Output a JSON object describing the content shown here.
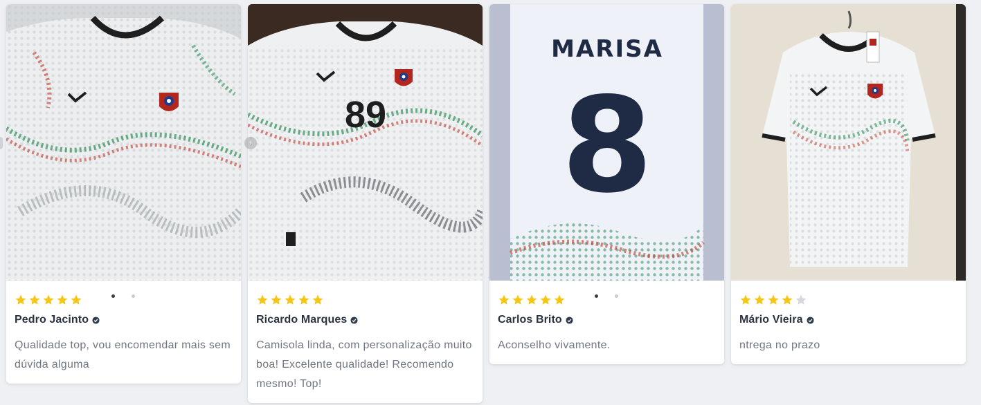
{
  "reviews": [
    {
      "rating": 5,
      "name": "Pedro Jacinto",
      "text": "Qualidade top, vou encomendar mais sem dúvida alguma",
      "photo": "white-jersey-front-logo",
      "has_dots": true,
      "active_dot": 0
    },
    {
      "rating": 5,
      "name": "Ricardo Marques",
      "text": "Camisola linda, com personalização muito boa! Excelente qualidade! Recomendo mesmo! Top!",
      "photo": "white-jersey-front-number",
      "jersey_number": "89",
      "has_dots": false
    },
    {
      "rating": 5,
      "name": "Carlos Brito",
      "text": "Aconselho vivamente.",
      "photo": "white-jersey-back-name",
      "jersey_name": "MARISA",
      "jersey_number": "8",
      "has_dots": true,
      "active_dot": 0
    },
    {
      "rating": 4,
      "name": "Mário Vieira",
      "text": "ntrega no prazo",
      "photo": "white-jersey-on-hanger",
      "has_dots": false
    }
  ],
  "colors": {
    "star_filled": "#f5c518",
    "star_empty": "#d4d7dc",
    "verified": "#2f3a4a",
    "pattern_green": "#2f8f5b",
    "pattern_red": "#c0392b",
    "collar": "#1e1e1e"
  }
}
